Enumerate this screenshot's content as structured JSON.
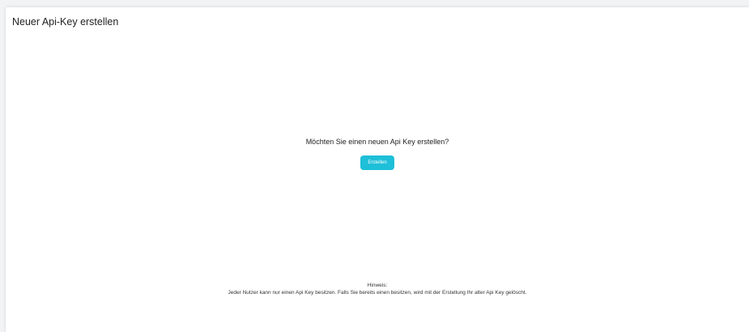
{
  "page": {
    "title": "Neuer Api-Key erstellen"
  },
  "main": {
    "question": "Möchten Sie einen neuen Api Key erstellen?",
    "create_label": "Erstellen"
  },
  "hint": {
    "heading": "Hinweis:",
    "text": "Jeder Nutzer kann nur einen Api Key besitzen. Falls Sie bereits einen besitzen, wird mit der Erstellung Ihr alter Api Key gelöscht."
  },
  "colors": {
    "accent": "#1ebfd8",
    "background": "#f2f3f5",
    "card": "#ffffff"
  }
}
